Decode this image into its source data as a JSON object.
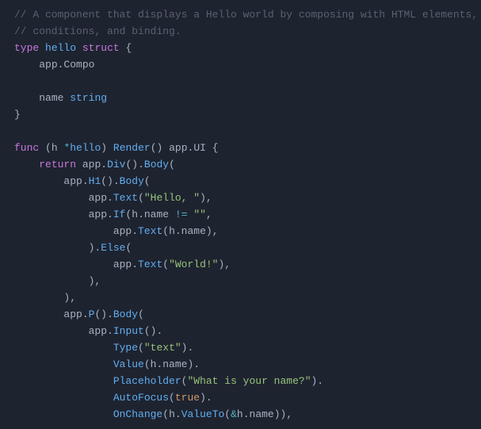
{
  "code": {
    "comment1": "// A component that displays a Hello world by composing with HTML elements,",
    "comment2": "// conditions, and binding.",
    "kw_type": "type",
    "ident_hello": "hello",
    "kw_struct": "struct",
    "brace_open": "{",
    "field_compo": "app.Compo",
    "field_name": "name",
    "type_string": "string",
    "brace_close": "}",
    "kw_func": "func",
    "receiver_open": "(h ",
    "receiver_star": "*",
    "receiver_type": "hello",
    "receiver_close": ")",
    "fn_render": "Render",
    "parens": "()",
    "ret_type": "app.UI",
    "kw_return": "return",
    "app": "app",
    "dot": ".",
    "m_div": "Div",
    "m_body": "Body",
    "m_h1": "H1",
    "m_text": "Text",
    "m_if": "If",
    "m_else": "Else",
    "m_p": "P",
    "m_input": "Input",
    "m_type": "Type",
    "m_value": "Value",
    "m_placeholder": "Placeholder",
    "m_autofocus": "AutoFocus",
    "m_onchange": "OnChange",
    "m_valueto": "ValueTo",
    "str_hello": "\"Hello, \"",
    "str_empty": "\"\"",
    "str_world": "\"World!\"",
    "str_text": "\"text\"",
    "str_prompt": "\"What is your name?\"",
    "expr_hname": "h.name",
    "op_neq": "!=",
    "bool_true": "true",
    "amp": "&",
    "open": "(",
    "close": ")",
    "close_comma": "),",
    "close_dot": ")."
  }
}
